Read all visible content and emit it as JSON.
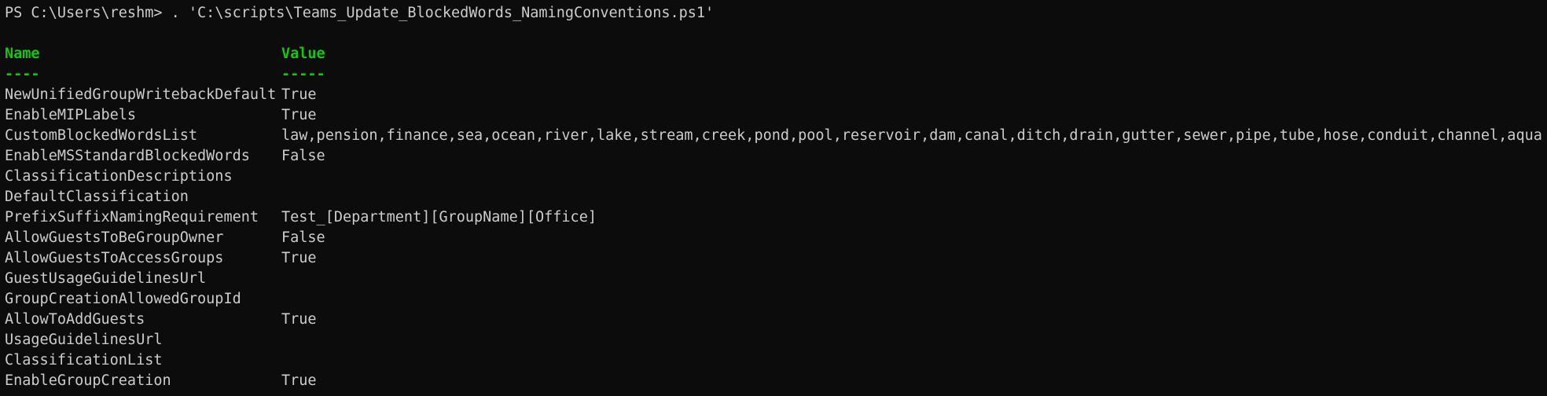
{
  "terminal": {
    "prompt": "PS C:\\Users\\reshm> ",
    "command": ". 'C:\\scripts\\Teams_Update_BlockedWords_NamingConventions.ps1'"
  },
  "table": {
    "headers": {
      "name": "Name",
      "value": "Value"
    },
    "separators": {
      "name": "----",
      "value": "-----"
    },
    "rows": [
      {
        "name": "NewUnifiedGroupWritebackDefault",
        "value": "True"
      },
      {
        "name": "EnableMIPLabels",
        "value": "True"
      },
      {
        "name": "CustomBlockedWordsList",
        "value": "law,pension,finance,sea,ocean,river,lake,stream,creek,pond,pool,reservoir,dam,canal,ditch,drain,gutter,sewer,pipe,tube,hose,conduit,channel,aqua"
      },
      {
        "name": "EnableMSStandardBlockedWords",
        "value": "False"
      },
      {
        "name": "ClassificationDescriptions",
        "value": ""
      },
      {
        "name": "DefaultClassification",
        "value": ""
      },
      {
        "name": "PrefixSuffixNamingRequirement",
        "value": "Test_[Department][GroupName][Office]"
      },
      {
        "name": "AllowGuestsToBeGroupOwner",
        "value": "False"
      },
      {
        "name": "AllowGuestsToAccessGroups",
        "value": "True"
      },
      {
        "name": "GuestUsageGuidelinesUrl",
        "value": ""
      },
      {
        "name": "GroupCreationAllowedGroupId",
        "value": ""
      },
      {
        "name": "AllowToAddGuests",
        "value": "True"
      },
      {
        "name": "UsageGuidelinesUrl",
        "value": ""
      },
      {
        "name": "ClassificationList",
        "value": ""
      },
      {
        "name": "EnableGroupCreation",
        "value": "True"
      }
    ]
  },
  "colors": {
    "background": "#0c0c0c",
    "foreground": "#cccccc",
    "header": "#16c60c"
  }
}
